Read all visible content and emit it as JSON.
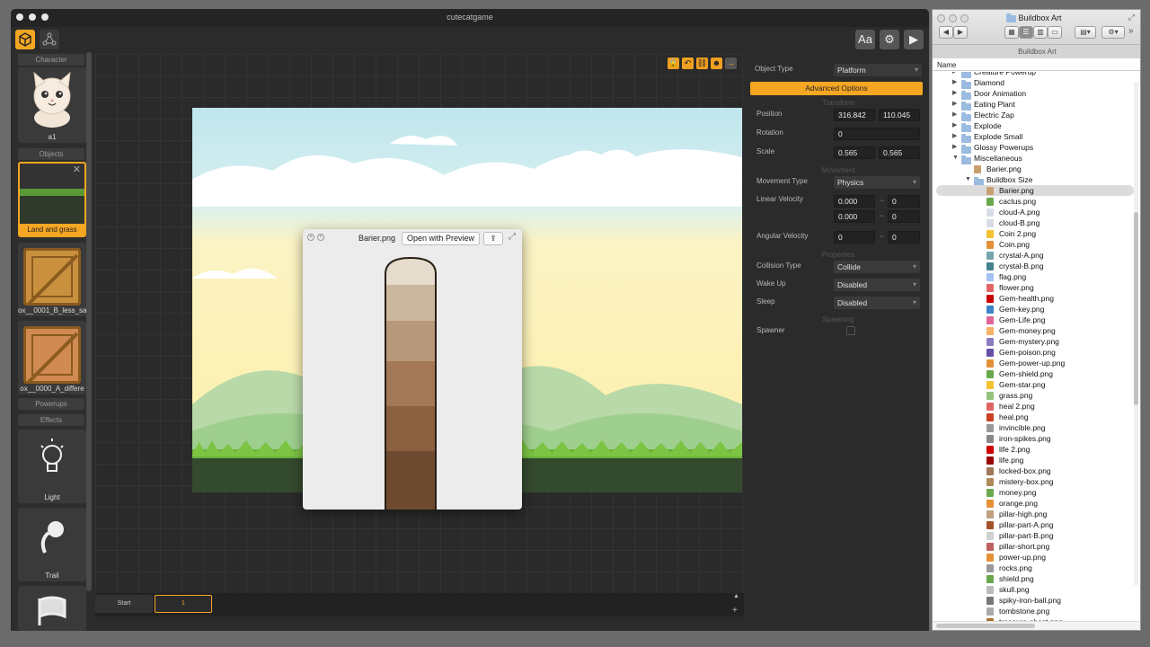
{
  "app": {
    "window_title": "cutecatgame",
    "toolbar_right": [
      "Aa",
      "⚙",
      "▶"
    ]
  },
  "left_panel": {
    "sections": {
      "character": "Character",
      "objects": "Objects",
      "powerups": "Powerups",
      "effects": "Effects"
    },
    "character_item": "a1",
    "object_items": [
      "Land and grass",
      "ox__0001_B_less_sa",
      "ox__0000_A_differe"
    ],
    "effect_items": [
      "Light",
      "Trail"
    ]
  },
  "timeline": {
    "start_label": "Start",
    "scene_number": "1"
  },
  "preview": {
    "filename": "Barier.png",
    "open_button": "Open with Preview"
  },
  "inspector": {
    "object_type_label": "Object Type",
    "object_type_value": "Platform",
    "advanced_button": "Advanced Options",
    "transform_header": "Transform",
    "position_label": "Position",
    "position_x": "316.842",
    "position_y": "110.045",
    "rotation_label": "Rotation",
    "rotation_value": "0",
    "scale_label": "Scale",
    "scale_x": "0.565",
    "scale_y": "0.565",
    "movement_header": "Movement",
    "movement_type_label": "Movement Type",
    "movement_type_value": "Physics",
    "linear_velocity_label": "Linear Velocity",
    "lv_row1_a": "0.000",
    "lv_row1_b": "0",
    "lv_row2_a": "0.000",
    "lv_row2_b": "0",
    "angular_velocity_label": "Angular Velocity",
    "av_a": "0",
    "av_b": "0",
    "range_separator": "~",
    "properties_header": "Properties",
    "collision_type_label": "Collision Type",
    "collision_type_value": "Collide",
    "wake_up_label": "Wake Up",
    "wake_up_value": "Disabled",
    "sleep_label": "Sleep",
    "sleep_value": "Disabled",
    "spawning_header": "Spawning",
    "spawner_label": "Spawner"
  },
  "finder": {
    "window_title": "Buildbox Art",
    "path_bar": "Buildbox Art",
    "column_header": "Name",
    "folders": [
      {
        "name": "Creature Powerup"
      },
      {
        "name": "Diamond"
      },
      {
        "name": "Door Animation"
      },
      {
        "name": "Eating Plant"
      },
      {
        "name": "Electric Zap"
      },
      {
        "name": "Explode"
      },
      {
        "name": "Explode Small"
      },
      {
        "name": "Glossy Powerups"
      },
      {
        "name": "Miscellaneous",
        "expanded": true
      }
    ],
    "misc_file": "Barier.png",
    "subfolder": "Buildbox Size",
    "files": [
      {
        "name": "Barier.png",
        "color": "#c8a070",
        "selected": true
      },
      {
        "name": "cactus.png",
        "color": "#6aa84f"
      },
      {
        "name": "cloud-A.png",
        "color": "#d8dde5"
      },
      {
        "name": "cloud-B.png",
        "color": "#d8dde5"
      },
      {
        "name": "Coin 2.png",
        "color": "#f1c232"
      },
      {
        "name": "Coin.png",
        "color": "#e69138"
      },
      {
        "name": "crystal-A.png",
        "color": "#76a5af"
      },
      {
        "name": "crystal-B.png",
        "color": "#45818e"
      },
      {
        "name": "flag.png",
        "color": "#a4c2f4"
      },
      {
        "name": "flower.png",
        "color": "#e06666"
      },
      {
        "name": "Gem-health.png",
        "color": "#cc0000"
      },
      {
        "name": "Gem-key.png",
        "color": "#3d85c6"
      },
      {
        "name": "Gem-Life.png",
        "color": "#e06699"
      },
      {
        "name": "Gem-money.png",
        "color": "#f6b26b"
      },
      {
        "name": "Gem-mystery.png",
        "color": "#8e7cc3"
      },
      {
        "name": "Gem-poison.png",
        "color": "#674ea7"
      },
      {
        "name": "Gem-power-up.png",
        "color": "#e69138"
      },
      {
        "name": "Gem-shield.png",
        "color": "#6aa84f"
      },
      {
        "name": "Gem-star.png",
        "color": "#f1c232"
      },
      {
        "name": "grass.png",
        "color": "#93c47d"
      },
      {
        "name": "heal 2.png",
        "color": "#e06666"
      },
      {
        "name": "heal.png",
        "color": "#cc4125"
      },
      {
        "name": "invincible.png",
        "color": "#999999"
      },
      {
        "name": "iron-spikes.png",
        "color": "#888888"
      },
      {
        "name": "life 2.png",
        "color": "#cc0000"
      },
      {
        "name": "life.png",
        "color": "#990000"
      },
      {
        "name": "locked-box.png",
        "color": "#a0785a"
      },
      {
        "name": "mistery-box.png",
        "color": "#b08a5a"
      },
      {
        "name": "money.png",
        "color": "#6aa84f"
      },
      {
        "name": "orange.png",
        "color": "#e69138"
      },
      {
        "name": "pillar-high.png",
        "color": "#c0a080"
      },
      {
        "name": "pillar-part-A.png",
        "color": "#a0522d"
      },
      {
        "name": "pillar-part-B.png",
        "color": "#d0d0d0"
      },
      {
        "name": "pillar-short.png",
        "color": "#c06060"
      },
      {
        "name": "power-up.png",
        "color": "#e69138"
      },
      {
        "name": "rocks.png",
        "color": "#999999"
      },
      {
        "name": "shield.png",
        "color": "#6aa84f"
      },
      {
        "name": "skull.png",
        "color": "#bbbbbb"
      },
      {
        "name": "spiky-iron-ball.png",
        "color": "#777777"
      },
      {
        "name": "tombstone.png",
        "color": "#aaaaaa"
      },
      {
        "name": "treasure-chest.png",
        "color": "#b07030"
      }
    ]
  },
  "colors": {
    "accent": "#f5a623",
    "panel": "#2b2b2b",
    "selection": "#dcdcdc"
  }
}
